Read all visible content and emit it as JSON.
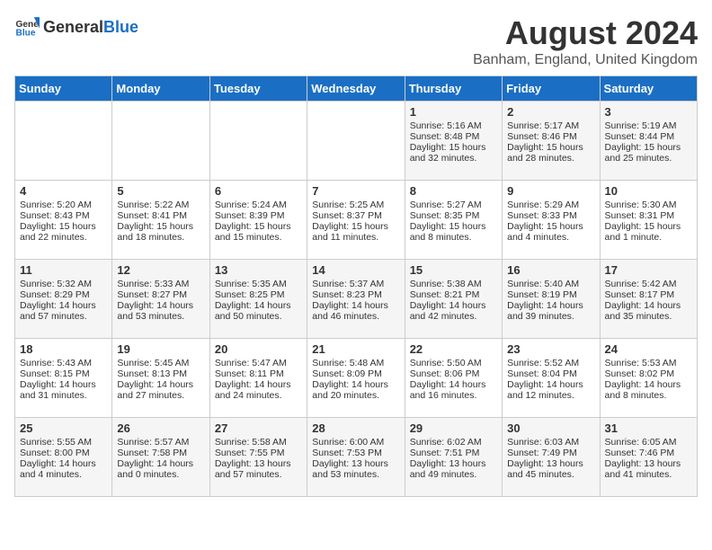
{
  "header": {
    "logo_general": "General",
    "logo_blue": "Blue",
    "month": "August 2024",
    "location": "Banham, England, United Kingdom"
  },
  "columns": [
    "Sunday",
    "Monday",
    "Tuesday",
    "Wednesday",
    "Thursday",
    "Friday",
    "Saturday"
  ],
  "weeks": [
    [
      {
        "day": "",
        "content": ""
      },
      {
        "day": "",
        "content": ""
      },
      {
        "day": "",
        "content": ""
      },
      {
        "day": "",
        "content": ""
      },
      {
        "day": "1",
        "content": "Sunrise: 5:16 AM\nSunset: 8:48 PM\nDaylight: 15 hours\nand 32 minutes."
      },
      {
        "day": "2",
        "content": "Sunrise: 5:17 AM\nSunset: 8:46 PM\nDaylight: 15 hours\nand 28 minutes."
      },
      {
        "day": "3",
        "content": "Sunrise: 5:19 AM\nSunset: 8:44 PM\nDaylight: 15 hours\nand 25 minutes."
      }
    ],
    [
      {
        "day": "4",
        "content": "Sunrise: 5:20 AM\nSunset: 8:43 PM\nDaylight: 15 hours\nand 22 minutes."
      },
      {
        "day": "5",
        "content": "Sunrise: 5:22 AM\nSunset: 8:41 PM\nDaylight: 15 hours\nand 18 minutes."
      },
      {
        "day": "6",
        "content": "Sunrise: 5:24 AM\nSunset: 8:39 PM\nDaylight: 15 hours\nand 15 minutes."
      },
      {
        "day": "7",
        "content": "Sunrise: 5:25 AM\nSunset: 8:37 PM\nDaylight: 15 hours\nand 11 minutes."
      },
      {
        "day": "8",
        "content": "Sunrise: 5:27 AM\nSunset: 8:35 PM\nDaylight: 15 hours\nand 8 minutes."
      },
      {
        "day": "9",
        "content": "Sunrise: 5:29 AM\nSunset: 8:33 PM\nDaylight: 15 hours\nand 4 minutes."
      },
      {
        "day": "10",
        "content": "Sunrise: 5:30 AM\nSunset: 8:31 PM\nDaylight: 15 hours\nand 1 minute."
      }
    ],
    [
      {
        "day": "11",
        "content": "Sunrise: 5:32 AM\nSunset: 8:29 PM\nDaylight: 14 hours\nand 57 minutes."
      },
      {
        "day": "12",
        "content": "Sunrise: 5:33 AM\nSunset: 8:27 PM\nDaylight: 14 hours\nand 53 minutes."
      },
      {
        "day": "13",
        "content": "Sunrise: 5:35 AM\nSunset: 8:25 PM\nDaylight: 14 hours\nand 50 minutes."
      },
      {
        "day": "14",
        "content": "Sunrise: 5:37 AM\nSunset: 8:23 PM\nDaylight: 14 hours\nand 46 minutes."
      },
      {
        "day": "15",
        "content": "Sunrise: 5:38 AM\nSunset: 8:21 PM\nDaylight: 14 hours\nand 42 minutes."
      },
      {
        "day": "16",
        "content": "Sunrise: 5:40 AM\nSunset: 8:19 PM\nDaylight: 14 hours\nand 39 minutes."
      },
      {
        "day": "17",
        "content": "Sunrise: 5:42 AM\nSunset: 8:17 PM\nDaylight: 14 hours\nand 35 minutes."
      }
    ],
    [
      {
        "day": "18",
        "content": "Sunrise: 5:43 AM\nSunset: 8:15 PM\nDaylight: 14 hours\nand 31 minutes."
      },
      {
        "day": "19",
        "content": "Sunrise: 5:45 AM\nSunset: 8:13 PM\nDaylight: 14 hours\nand 27 minutes."
      },
      {
        "day": "20",
        "content": "Sunrise: 5:47 AM\nSunset: 8:11 PM\nDaylight: 14 hours\nand 24 minutes."
      },
      {
        "day": "21",
        "content": "Sunrise: 5:48 AM\nSunset: 8:09 PM\nDaylight: 14 hours\nand 20 minutes."
      },
      {
        "day": "22",
        "content": "Sunrise: 5:50 AM\nSunset: 8:06 PM\nDaylight: 14 hours\nand 16 minutes."
      },
      {
        "day": "23",
        "content": "Sunrise: 5:52 AM\nSunset: 8:04 PM\nDaylight: 14 hours\nand 12 minutes."
      },
      {
        "day": "24",
        "content": "Sunrise: 5:53 AM\nSunset: 8:02 PM\nDaylight: 14 hours\nand 8 minutes."
      }
    ],
    [
      {
        "day": "25",
        "content": "Sunrise: 5:55 AM\nSunset: 8:00 PM\nDaylight: 14 hours\nand 4 minutes."
      },
      {
        "day": "26",
        "content": "Sunrise: 5:57 AM\nSunset: 7:58 PM\nDaylight: 14 hours\nand 0 minutes."
      },
      {
        "day": "27",
        "content": "Sunrise: 5:58 AM\nSunset: 7:55 PM\nDaylight: 13 hours\nand 57 minutes."
      },
      {
        "day": "28",
        "content": "Sunrise: 6:00 AM\nSunset: 7:53 PM\nDaylight: 13 hours\nand 53 minutes."
      },
      {
        "day": "29",
        "content": "Sunrise: 6:02 AM\nSunset: 7:51 PM\nDaylight: 13 hours\nand 49 minutes."
      },
      {
        "day": "30",
        "content": "Sunrise: 6:03 AM\nSunset: 7:49 PM\nDaylight: 13 hours\nand 45 minutes."
      },
      {
        "day": "31",
        "content": "Sunrise: 6:05 AM\nSunset: 7:46 PM\nDaylight: 13 hours\nand 41 minutes."
      }
    ]
  ]
}
